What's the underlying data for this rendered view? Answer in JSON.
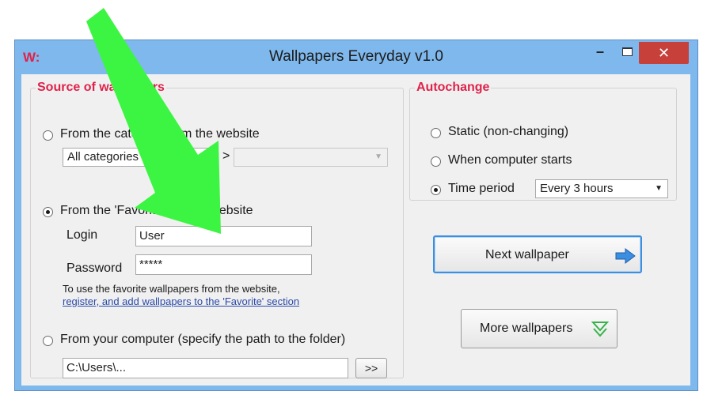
{
  "window": {
    "title": "Wallpapers Everyday v1.0",
    "app_icon": "W:"
  },
  "source_group": {
    "legend": "Source of wallpapers",
    "category_option": "From the category from the website",
    "category_select": "All categories",
    "category_separator": ">",
    "favorites_option": "From the 'Favorites' of the website",
    "login_label": "Login",
    "login_value": "User",
    "password_label": "Password",
    "password_value": "*****",
    "hint_line1": "To use the favorite wallpapers from the website,",
    "hint_link": "register, and add wallpapers to the 'Favorite' section",
    "computer_option": "From your computer (specify the path to the folder)",
    "path_value": "C:\\Users\\...",
    "browse_label": ">>"
  },
  "autochange_group": {
    "legend": "Autochange",
    "static_option": "Static (non-changing)",
    "startup_option": "When computer starts",
    "period_option": "Time period",
    "period_select": "Every 3 hours"
  },
  "buttons": {
    "next_wallpaper": "Next wallpaper",
    "more_wallpapers": "More wallpapers"
  },
  "colors": {
    "accent": "#e0224a",
    "overlay_arrow": "#3cf542",
    "title_bar": "#7fb8ec",
    "close": "#c7403a"
  }
}
